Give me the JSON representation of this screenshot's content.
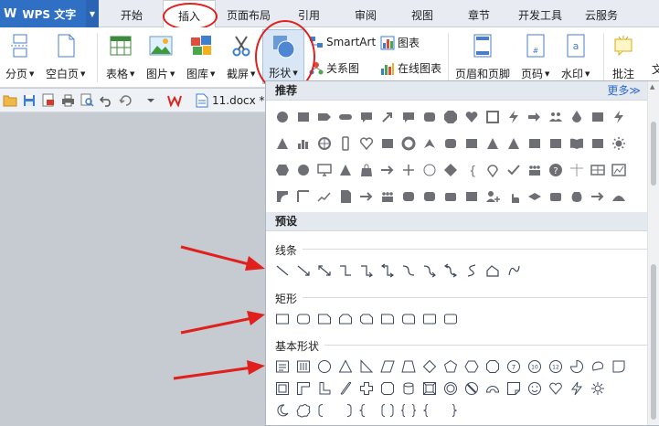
{
  "app": {
    "logo": "W",
    "name": "WPS 文字"
  },
  "menu_tabs": [
    "开始",
    "插入",
    "页面布局",
    "引用",
    "审阅",
    "视图",
    "章节",
    "开发工具",
    "云服务"
  ],
  "ribbon": {
    "page_break": "分页",
    "blank_page": "空白页",
    "table": "表格",
    "picture": "图片",
    "gallery": "图库",
    "screenshot": "截屏",
    "shapes": "形状",
    "smartart": "SmartArt",
    "chart": "图表",
    "relation": "关系图",
    "online_chart": "在线图表",
    "header_footer": "页眉和页脚",
    "page_number": "页码",
    "watermark": "水印",
    "comment": "批注",
    "cut_text": "文"
  },
  "document": {
    "filename": "11.docx *"
  },
  "shape_panel": {
    "recommended_title": "推荐",
    "more_label": "更多≫",
    "preset_title": "预设",
    "categories": {
      "lines": "线条",
      "rectangles": "矩形",
      "basic": "基本形状"
    }
  },
  "colors": {
    "accent": "#2f6fc4",
    "annotation": "#e0201c",
    "shape_fill": "#6d6f74"
  }
}
